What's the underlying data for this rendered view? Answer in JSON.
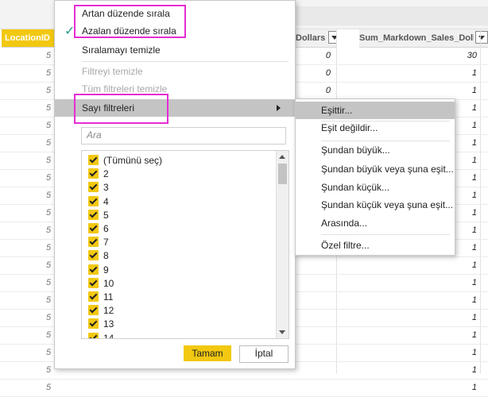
{
  "grid": {
    "header_location": "LocationID",
    "header_col2": "Dollars",
    "header_col3": "Sum_Markdown_Sales_Dollars",
    "col2_values": [
      "0",
      "0",
      "0"
    ],
    "col3_values": [
      "30",
      "1",
      "1",
      "1",
      "1",
      "1",
      "1",
      "1",
      "1",
      "1",
      "1",
      "1",
      "1",
      "1",
      "1",
      "1",
      "1",
      "1",
      "1",
      "1"
    ],
    "col1_values": [
      "5",
      "5",
      "5",
      "5",
      "5",
      "5",
      "5",
      "5",
      "5",
      "5",
      "5",
      "5",
      "5",
      "5",
      "5",
      "5",
      "5",
      "5",
      "5",
      "5"
    ]
  },
  "menu": {
    "sort_asc": "Artan düzende sırala",
    "sort_desc": "Azalan düzende sırala",
    "clear_sort": "Sıralamayı temizle",
    "clear_filter": "Filtreyi temizle",
    "clear_all_filters": "Tüm filtreleri temizle",
    "number_filters": "Sayı filtreleri",
    "search_placeholder": "Ara",
    "items": [
      "(Tümünü seç)",
      "2",
      "3",
      "4",
      "5",
      "6",
      "7",
      "8",
      "9",
      "10",
      "11",
      "12",
      "13",
      "14"
    ],
    "ok_label": "Tamam",
    "cancel_label": "İptal"
  },
  "submenu": {
    "equals": "Eşittir...",
    "not_equals": "Eşit değildir...",
    "greater": "Şundan büyük...",
    "greater_or_equal": "Şundan büyük veya şuna eşit...",
    "less": "Şundan küçük...",
    "less_or_equal": "Şundan küçük veya şuna eşit...",
    "between": "Arasında...",
    "custom": "Özel filtre..."
  },
  "colors": {
    "accent_yellow": "#f2c811",
    "highlight_pink": "#e52cd4",
    "check_teal": "#2a9c8c",
    "selected_row": "#c4c4c4"
  },
  "icons": {
    "check": "check-icon",
    "submenu_arrow": "chevron-right-icon",
    "checkbox": "checkbox-checked-icon",
    "scroll_up": "arrow-up-icon",
    "scroll_down": "arrow-down-icon",
    "column_dropdown": "dropdown-arrow-icon"
  }
}
